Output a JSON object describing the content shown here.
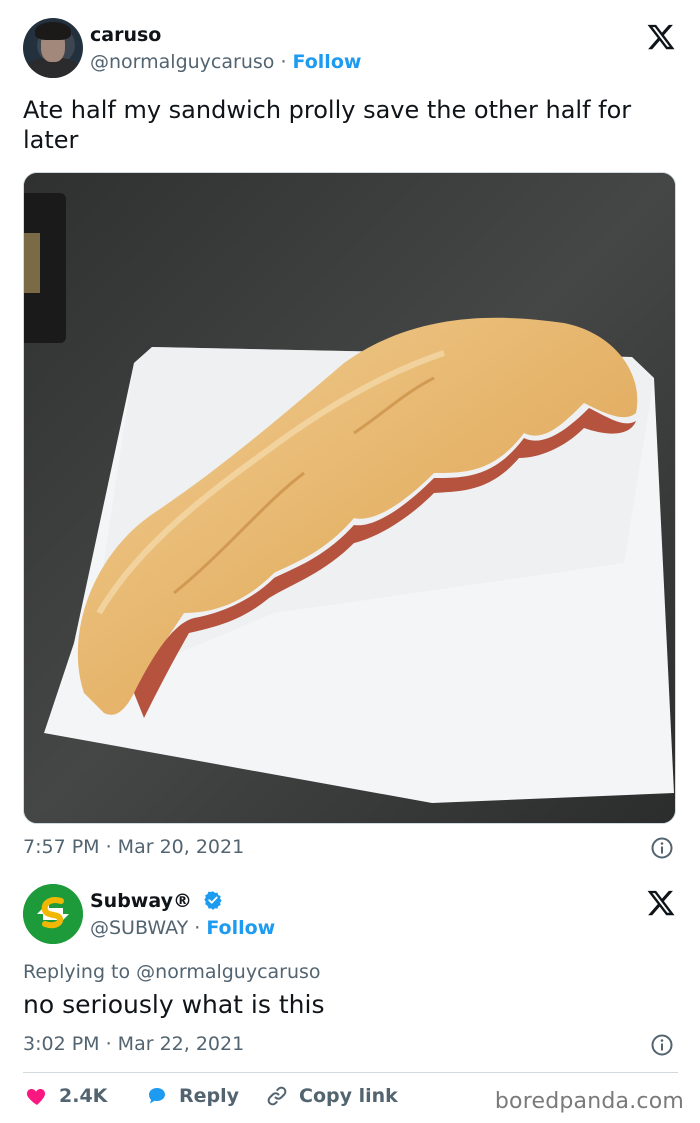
{
  "tweet": {
    "display_name": "caruso",
    "handle": "@normalguycaruso",
    "separator": "·",
    "follow_label": "Follow",
    "text": "Ate half my sandwich prolly save the other half for later",
    "time": "7:57 PM",
    "date": "Mar 20, 2021",
    "timestamp": "7:57 PM · Mar 20, 2021",
    "photo_icon": "photo-sandwich"
  },
  "reply": {
    "display_name": "Subway®",
    "handle": "@SUBWAY",
    "separator": "·",
    "follow_label": "Follow",
    "replying_prefix": "Replying to",
    "replying_to": "@normalguycaruso",
    "text": "no seriously what is this",
    "timestamp": "3:02 PM · Mar 22, 2021",
    "verified_icon": "verified-badge-icon"
  },
  "actions": {
    "like_count": "2.4K",
    "reply_label": "Reply",
    "copy_link_label": "Copy link"
  },
  "watermark": "boredpanda.com",
  "colors": {
    "accent": "#1d9bf0",
    "like": "#f91880",
    "secondary_text": "#536471",
    "subway_green": "#1d9b3a",
    "subway_yellow": "#f2b705"
  }
}
